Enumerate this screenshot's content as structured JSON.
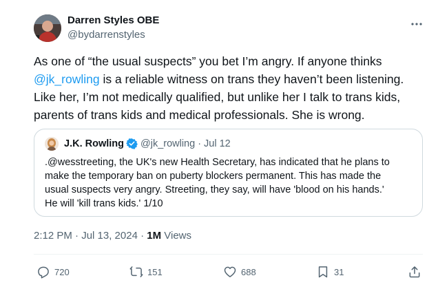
{
  "author": {
    "name": "Darren Styles OBE",
    "handle": "@bydarrenstyles"
  },
  "tweet": {
    "line1": "As one of “the usual suspects” you bet I’m angry. If anyone thinks",
    "mention": "@jk_rowling",
    "line2_rest": " is a reliable witness on trans they haven’t been listening.",
    "line3": "Like her, I’m not medically qualified, but unlike her I talk to trans kids,",
    "line4": "parents of trans kids and medical professionals. She is wrong."
  },
  "quote": {
    "name": "J.K. Rowling",
    "handle": "@jk_rowling",
    "separator": "·",
    "date": "Jul 12",
    "lines": [
      ".@wesstreeting, the UK's new Health Secretary, has indicated that he plans to",
      "make the temporary ban on puberty blockers permanent. This has made the",
      "usual suspects very angry. Streeting, they say, will have 'blood on his hands.'",
      "He will 'kill trans kids.' 1/10"
    ]
  },
  "meta": {
    "timestamp": "2:12 PM · Jul 13, 2024 · ",
    "views_count": "1M",
    "views_label": " Views"
  },
  "actions": {
    "replies": "720",
    "reposts": "151",
    "likes": "688",
    "bookmarks": "31"
  },
  "colors": {
    "link": "#1d9bf0",
    "secondary_text": "#536471",
    "border": "#cfd9de",
    "verified": "#1d9bf0"
  },
  "icons": [
    "more-icon",
    "verified-badge-icon",
    "reply-icon",
    "repost-icon",
    "like-icon",
    "bookmark-icon",
    "share-icon"
  ]
}
